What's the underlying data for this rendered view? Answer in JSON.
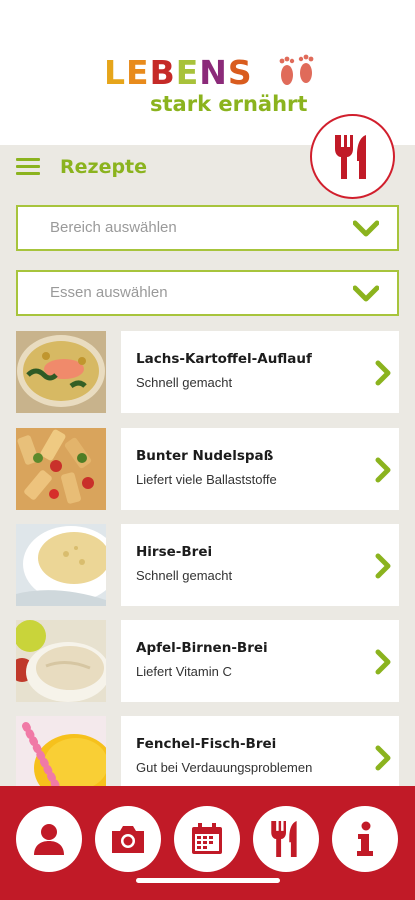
{
  "logo": {
    "letters": [
      "L",
      "E",
      "B",
      "E",
      "N",
      "S"
    ],
    "letter_colors": [
      "#e6a51a",
      "#e88b1c",
      "#c52a27",
      "#a8c23a",
      "#8b2a79",
      "#d95c1e"
    ],
    "subtitle": "stark ernährt",
    "accent": "#8bb31e"
  },
  "header": {
    "title": "Rezepte",
    "menu_icon": "hamburger-icon",
    "badge_icon": "fork-knife-icon"
  },
  "filters": [
    {
      "placeholder": "Bereich auswählen"
    },
    {
      "placeholder": "Essen auswählen"
    }
  ],
  "recipes": [
    {
      "title": "Lachs-Kartoffel-Auflauf",
      "subtitle": "Schnell gemacht"
    },
    {
      "title": "Bunter Nudelspaß",
      "subtitle": "Liefert viele Ballaststoffe"
    },
    {
      "title": "Hirse-Brei",
      "subtitle": "Schnell gemacht"
    },
    {
      "title": "Apfel-Birnen-Brei",
      "subtitle": "Liefert Vitamin C"
    },
    {
      "title": "Fenchel-Fisch-Brei",
      "subtitle": "Gut bei Verdauungsproblemen"
    }
  ],
  "bottom_nav": [
    "profile-icon",
    "camera-icon",
    "calendar-icon",
    "fork-knife-icon",
    "info-icon"
  ],
  "colors": {
    "brand_red": "#c11a27",
    "brand_green": "#8bb31e",
    "background": "#ebe9e3"
  }
}
